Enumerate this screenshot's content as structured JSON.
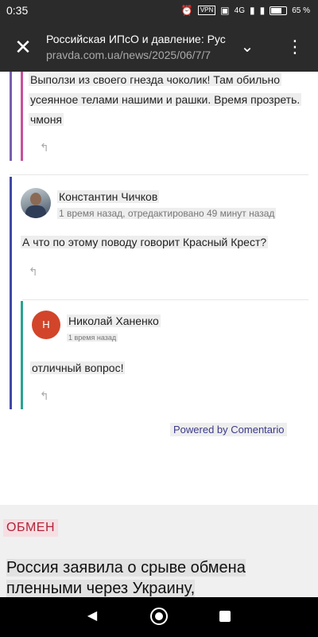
{
  "status_bar": {
    "time": "0:35",
    "vpn": "VPN",
    "net": "4G",
    "battery": "65 %"
  },
  "toolbar": {
    "title": "Российская ИПсО и давление: Рус",
    "url": "pravda.com.ua/news/2025/06/7/7"
  },
  "comments": [
    {
      "lines": [
        "Выползи из своего гнезда чоколик! Там обильно",
        "усеянное телами нашими и рашки. Время прозреть.",
        "чмоня"
      ]
    },
    {
      "author": "Константин Чичков",
      "meta": "1 время назад, отредактировано 49 минут назад",
      "text": "А что по этому поводу говорит Красный Крест?"
    },
    {
      "author": "Николай Ханенко",
      "avatar_letter": "Н",
      "meta": "1 время назад",
      "text": "отличный вопрос!"
    }
  ],
  "powered_by": "Powered by Comentario",
  "section": {
    "tag": "ОБМЕН",
    "headline_line1": "Россия заявила о срыве обмена",
    "headline_line2": "пленными через Украину,"
  },
  "colors": {
    "thread_pink": "#c8509a",
    "thread_purple": "#7a5fae",
    "thread_blue": "#3f49a8",
    "thread_teal": "#2aa38f",
    "avatar_red": "#d2452a"
  },
  "icons": [
    "close-icon",
    "chevron-down-icon",
    "more-vert-icon",
    "reply-icon",
    "back-icon",
    "home-icon",
    "recents-icon"
  ]
}
